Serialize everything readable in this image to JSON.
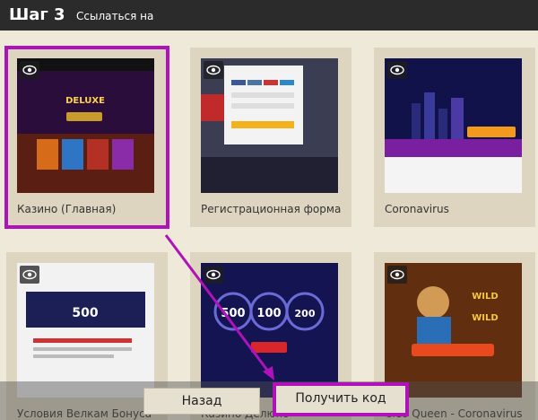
{
  "header": {
    "step": "Шаг 3",
    "subtitle": "Ссылаться на"
  },
  "cards": [
    {
      "label": "Казино (Главная)",
      "selected": true
    },
    {
      "label": "Регистрационная форма",
      "selected": false
    },
    {
      "label": "Coronavirus",
      "selected": false
    },
    {
      "label": "Условия Велкам Бонуса",
      "selected": false
    },
    {
      "label": "Казино Делюкс",
      "selected": false
    },
    {
      "label": "Cleo Queen - Coronavirus",
      "selected": false
    }
  ],
  "buttons": {
    "back": "Назад",
    "get_code": "Получить код"
  },
  "colors": {
    "accent": "#b012b9",
    "header_bg": "#2b2b2b",
    "card_bg": "#ddd5c0"
  }
}
